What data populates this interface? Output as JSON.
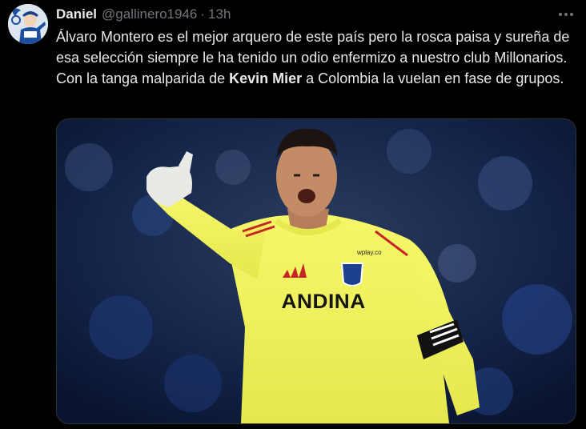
{
  "tweet": {
    "author_name": "Daniel",
    "handle": "@gallinero1946",
    "separator": "·",
    "time": "13h",
    "text_part1": "Álvaro Montero es el mejor arquero de este país pero la rosca paisa y sureña de esa selección siempre le ha tenido un odio enfermizo a nuestro club Millonarios. Con la tanga malparida de ",
    "text_bold": "Kevin Mier",
    "text_part2": " a Colombia la vuelan en fase de grupos."
  },
  "media": {
    "jersey_text": "ANDINA",
    "sponsor_text": "wplay.co"
  },
  "icons": {
    "more": "more-dots-icon"
  },
  "colors": {
    "background": "#000000",
    "text": "#e7e9ea",
    "secondary": "#71767b",
    "jersey": "#f0f05a"
  }
}
